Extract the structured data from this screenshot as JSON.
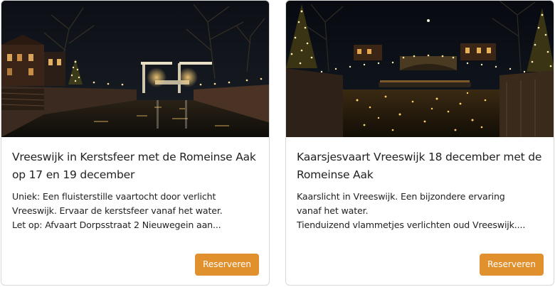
{
  "cards": [
    {
      "title": "Vreeswijk in Kerstsfeer met de Romeinse Aak op 17 en 19 december",
      "description_lines": [
        "Uniek: Een fluisterstille vaartocht door verlicht",
        "Vreeswijk. Ervaar de kerstsfeer vanaf het water.",
        "Let op: Afvaart Dorpsstraat 2 Nieuwegein aan..."
      ],
      "button_label": "Reserveren"
    },
    {
      "title": "Kaarsjesvaart Vreeswijk 18 december met de Romeinse Aak",
      "description_lines": [
        "Kaarslicht in Vreeswijk. Een bijzondere ervaring",
        "vanaf het water.",
        "Tienduizend vlammetjes verlichten oud Vreeswijk...."
      ],
      "button_label": "Reserveren"
    }
  ],
  "colors": {
    "button": "#e0902c",
    "button_text": "#ffffff",
    "text": "#222222",
    "card_border": "#d9d9d9"
  }
}
